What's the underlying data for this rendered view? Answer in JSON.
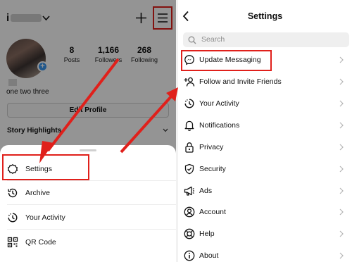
{
  "profile": {
    "stats": [
      {
        "value": "8",
        "label": "Posts"
      },
      {
        "value": "1,166",
        "label": "Followers"
      },
      {
        "value": "268",
        "label": "Following"
      }
    ],
    "bio": "one two three",
    "edit_profile": "Edit Profile",
    "story_highlights": "Story Highlights"
  },
  "sheet": {
    "items": [
      {
        "label": "Settings",
        "icon": "settings-gear-icon"
      },
      {
        "label": "Archive",
        "icon": "archive-history-icon"
      },
      {
        "label": "Your Activity",
        "icon": "activity-icon"
      },
      {
        "label": "QR Code",
        "icon": "qr-code-icon"
      }
    ]
  },
  "settings": {
    "title": "Settings",
    "search_placeholder": "Search",
    "items": [
      {
        "label": "Update Messaging",
        "icon": "messenger-icon"
      },
      {
        "label": "Follow and Invite Friends",
        "icon": "add-person-icon"
      },
      {
        "label": "Your Activity",
        "icon": "activity-icon"
      },
      {
        "label": "Notifications",
        "icon": "bell-icon"
      },
      {
        "label": "Privacy",
        "icon": "lock-icon"
      },
      {
        "label": "Security",
        "icon": "shield-icon"
      },
      {
        "label": "Ads",
        "icon": "megaphone-icon"
      },
      {
        "label": "Account",
        "icon": "account-icon"
      },
      {
        "label": "Help",
        "icon": "lifebuoy-icon"
      },
      {
        "label": "About",
        "icon": "info-icon"
      }
    ]
  },
  "colors": {
    "highlight": "#e0201b",
    "accent": "#3897f0"
  }
}
